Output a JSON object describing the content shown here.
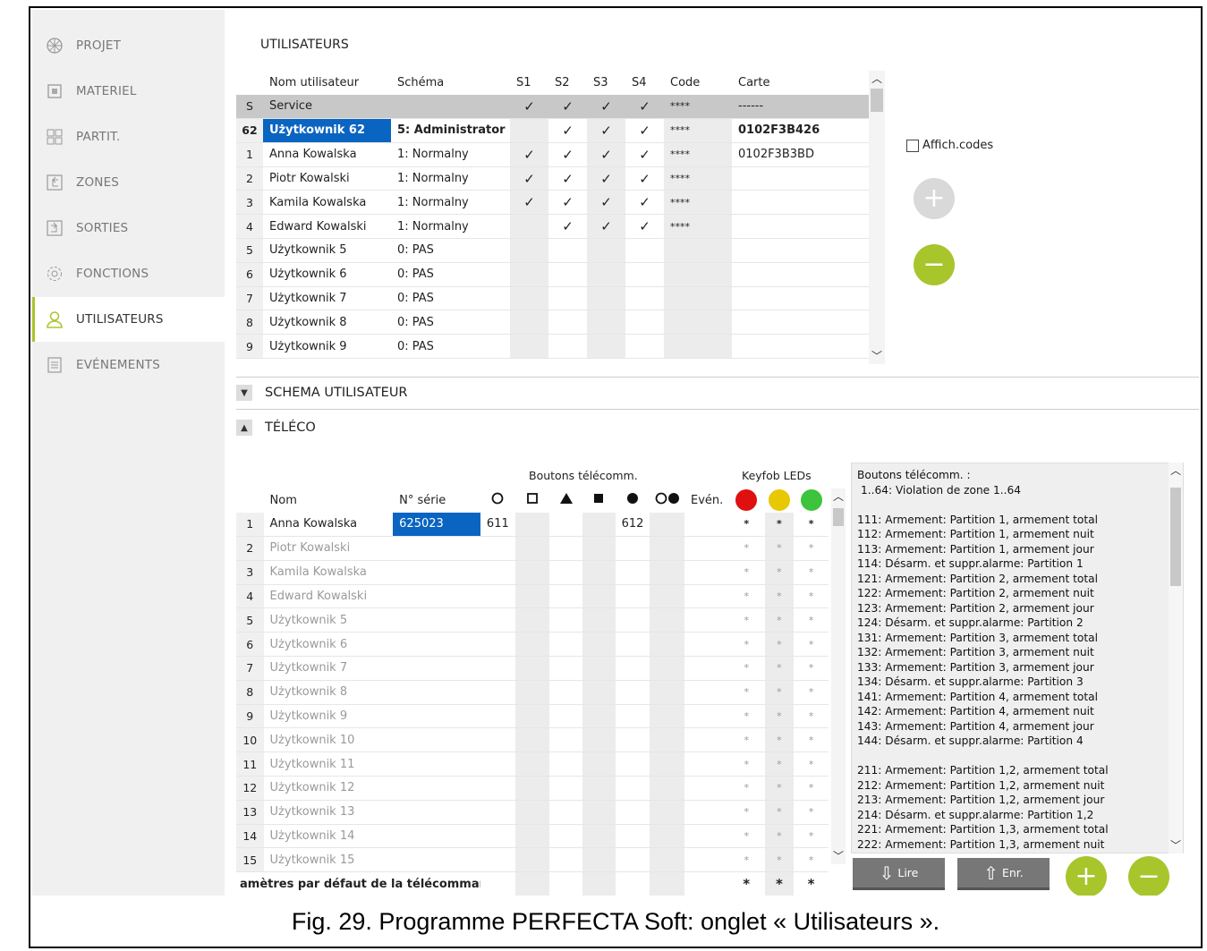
{
  "sidebar": {
    "items": [
      {
        "label": "PROJET",
        "icon": "project-icon"
      },
      {
        "label": "MATERIEL",
        "icon": "hardware-icon"
      },
      {
        "label": "PARTIT.",
        "icon": "partitions-icon"
      },
      {
        "label": "ZONES",
        "icon": "zones-icon"
      },
      {
        "label": "SORTIES",
        "icon": "outputs-icon"
      },
      {
        "label": "FONCTIONS",
        "icon": "functions-icon"
      },
      {
        "label": "UTILISATEURS",
        "icon": "user-icon"
      },
      {
        "label": "EVÉNEMENTS",
        "icon": "events-icon"
      }
    ]
  },
  "users": {
    "title": "UTILISATEURS",
    "headers": [
      "",
      "Nom utilisateur",
      "Schéma",
      "S1",
      "S2",
      "S3",
      "S4",
      "Code",
      "Carte"
    ],
    "rows": [
      {
        "num": "S",
        "name": "Service",
        "schema": "",
        "s1": "✓",
        "s2": "✓",
        "s3": "✓",
        "s4": "✓",
        "code": "****",
        "card": "------"
      },
      {
        "num": "62",
        "name": "Użytkownik 62",
        "schema": "5: Administrator",
        "s1": "",
        "s2": "✓",
        "s3": "✓",
        "s4": "✓",
        "code": "****",
        "card": "0102F3B426"
      },
      {
        "num": "1",
        "name": "Anna Kowalska",
        "schema": "1: Normalny",
        "s1": "✓",
        "s2": "✓",
        "s3": "✓",
        "s4": "✓",
        "code": "****",
        "card": "0102F3B3BD"
      },
      {
        "num": "2",
        "name": "Piotr Kowalski",
        "schema": "1: Normalny",
        "s1": "✓",
        "s2": "✓",
        "s3": "✓",
        "s4": "✓",
        "code": "****",
        "card": ""
      },
      {
        "num": "3",
        "name": "Kamila Kowalska",
        "schema": "1: Normalny",
        "s1": "✓",
        "s2": "✓",
        "s3": "✓",
        "s4": "✓",
        "code": "****",
        "card": ""
      },
      {
        "num": "4",
        "name": "Edward Kowalski",
        "schema": "1: Normalny",
        "s1": "",
        "s2": "✓",
        "s3": "✓",
        "s4": "✓",
        "code": "****",
        "card": ""
      },
      {
        "num": "5",
        "name": "Użytkownik 5",
        "schema": "0: PAS",
        "s1": "",
        "s2": "",
        "s3": "",
        "s4": "",
        "code": "",
        "card": ""
      },
      {
        "num": "6",
        "name": "Użytkownik 6",
        "schema": "0: PAS",
        "s1": "",
        "s2": "",
        "s3": "",
        "s4": "",
        "code": "",
        "card": ""
      },
      {
        "num": "7",
        "name": "Użytkownik 7",
        "schema": "0: PAS",
        "s1": "",
        "s2": "",
        "s3": "",
        "s4": "",
        "code": "",
        "card": ""
      },
      {
        "num": "8",
        "name": "Użytkownik 8",
        "schema": "0: PAS",
        "s1": "",
        "s2": "",
        "s3": "",
        "s4": "",
        "code": "",
        "card": ""
      },
      {
        "num": "9",
        "name": "Użytkownik 9",
        "schema": "0: PAS",
        "s1": "",
        "s2": "",
        "s3": "",
        "s4": "",
        "code": "",
        "card": ""
      }
    ],
    "show_codes_label": "Affich.codes",
    "add_button": "+",
    "remove_button": "−"
  },
  "schema_section": {
    "title": "SCHEMA UTILISATEUR"
  },
  "remote": {
    "title": "TÉLÉCO",
    "group_buttons": "Boutons télécomm.",
    "group_leds": "Keyfob LEDs",
    "col_name": "Nom",
    "col_serial": "N° série",
    "col_events": "Evén.",
    "rows": [
      {
        "num": "1",
        "name": "Anna Kowalska",
        "serial": "625023",
        "b1": "611",
        "b5": "612",
        "active": true
      },
      {
        "num": "2",
        "name": "Piotr Kowalski",
        "serial": "",
        "b1": "",
        "b5": "",
        "active": false
      },
      {
        "num": "3",
        "name": "Kamila Kowalska",
        "serial": "",
        "b1": "",
        "b5": "",
        "active": false
      },
      {
        "num": "4",
        "name": "Edward Kowalski",
        "serial": "",
        "b1": "",
        "b5": "",
        "active": false
      },
      {
        "num": "5",
        "name": "Użytkownik 5",
        "serial": "",
        "b1": "",
        "b5": "",
        "active": false
      },
      {
        "num": "6",
        "name": "Użytkownik 6",
        "serial": "",
        "b1": "",
        "b5": "",
        "active": false
      },
      {
        "num": "7",
        "name": "Użytkownik 7",
        "serial": "",
        "b1": "",
        "b5": "",
        "active": false
      },
      {
        "num": "8",
        "name": "Użytkownik 8",
        "serial": "",
        "b1": "",
        "b5": "",
        "active": false
      },
      {
        "num": "9",
        "name": "Użytkownik 9",
        "serial": "",
        "b1": "",
        "b5": "",
        "active": false
      },
      {
        "num": "10",
        "name": "Użytkownik 10",
        "serial": "",
        "b1": "",
        "b5": "",
        "active": false
      },
      {
        "num": "11",
        "name": "Użytkownik 11",
        "serial": "",
        "b1": "",
        "b5": "",
        "active": false
      },
      {
        "num": "12",
        "name": "Użytkownik 12",
        "serial": "",
        "b1": "",
        "b5": "",
        "active": false
      },
      {
        "num": "13",
        "name": "Użytkownik 13",
        "serial": "",
        "b1": "",
        "b5": "",
        "active": false
      },
      {
        "num": "14",
        "name": "Użytkownik 14",
        "serial": "",
        "b1": "",
        "b5": "",
        "active": false
      },
      {
        "num": "15",
        "name": "Użytkownik 15",
        "serial": "",
        "b1": "",
        "b5": "",
        "active": false
      }
    ],
    "led_value": "*",
    "footer_label": "amètres par défaut de la télécomman",
    "led_colors": [
      "#e01010",
      "#e8c800",
      "#3cc43c"
    ]
  },
  "info": {
    "title": "Boutons télécomm. :",
    "lines": [
      "1..64: Violation de zone 1..64",
      "",
      "111: Armement: Partition 1, armement total",
      "112: Armement: Partition 1, armement nuit",
      "113: Armement: Partition 1, armement jour",
      "114: Désarm. et suppr.alarme: Partition 1",
      "121: Armement: Partition 2, armement total",
      "122: Armement: Partition 2, armement nuit",
      "123: Armement: Partition 2, armement jour",
      "124: Désarm. et suppr.alarme: Partition 2",
      "131: Armement: Partition 3, armement total",
      "132: Armement: Partition 3, armement nuit",
      "133: Armement: Partition 3, armement jour",
      "134: Désarm. et suppr.alarme: Partition 3",
      "141: Armement: Partition 4, armement total",
      "142: Armement: Partition 4, armement nuit",
      "143: Armement: Partition 4, armement jour",
      "144: Désarm. et suppr.alarme: Partition 4",
      "",
      "211: Armement: Partition 1,2, armement total",
      "212: Armement: Partition 1,2, armement nuit",
      "213: Armement: Partition 1,2, armement jour",
      "214: Désarm. et suppr.alarme: Partition 1,2",
      "221: Armement: Partition 1,3, armement total",
      "222: Armement: Partition 1,3, armement nuit"
    ]
  },
  "actions": {
    "read": "Lire",
    "save": "Enr.",
    "add": "+",
    "remove": "−"
  },
  "caption": "Fig. 29. Programme PERFECTA Soft: onglet « Utilisateurs ».",
  "colors": {
    "accent": "#a8c52b",
    "selection": "#0a64c2"
  }
}
